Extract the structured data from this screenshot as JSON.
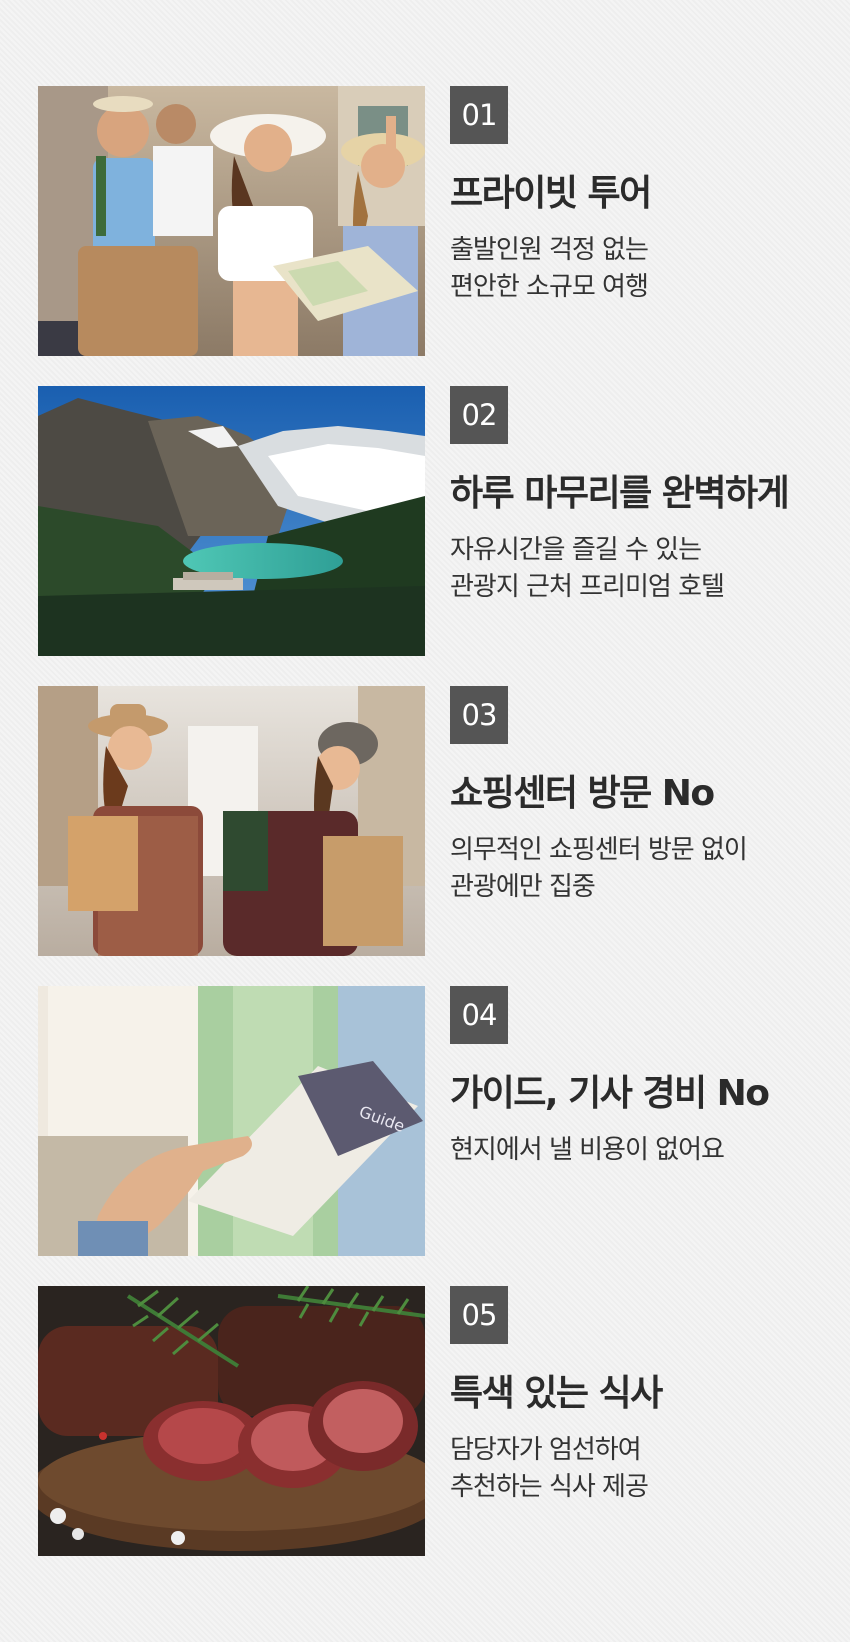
{
  "features": [
    {
      "number": "01",
      "title": "프라이빗 투어",
      "desc_lines": [
        "출발인원 걱정 없는",
        "편안한 소규모 여행"
      ],
      "photo": "tourists-group-with-map"
    },
    {
      "number": "02",
      "title": "하루 마무리를 완벽하게",
      "desc_lines": [
        "자유시간을 즐길 수 있는",
        "관광지 근처 프리미엄 호텔"
      ],
      "photo": "mountain-lake-hotel"
    },
    {
      "number": "03",
      "title": "쇼핑센터 방문 No",
      "desc_lines": [
        "의무적인 쇼핑센터 방문 없이",
        "관광에만 집중"
      ],
      "photo": "women-with-shopping-bags"
    },
    {
      "number": "04",
      "title": "가이드, 기사 경비 No",
      "desc_lines": [
        "현지에서 낼 비용이 없어요"
      ],
      "photo": "hand-holding-guidebook",
      "photo_text": "Guide"
    },
    {
      "number": "05",
      "title": "특색 있는 식사",
      "desc_lines": [
        "담당자가 엄선하여",
        "추천하는 식사 제공"
      ],
      "photo": "sliced-steak-with-rosemary"
    }
  ]
}
